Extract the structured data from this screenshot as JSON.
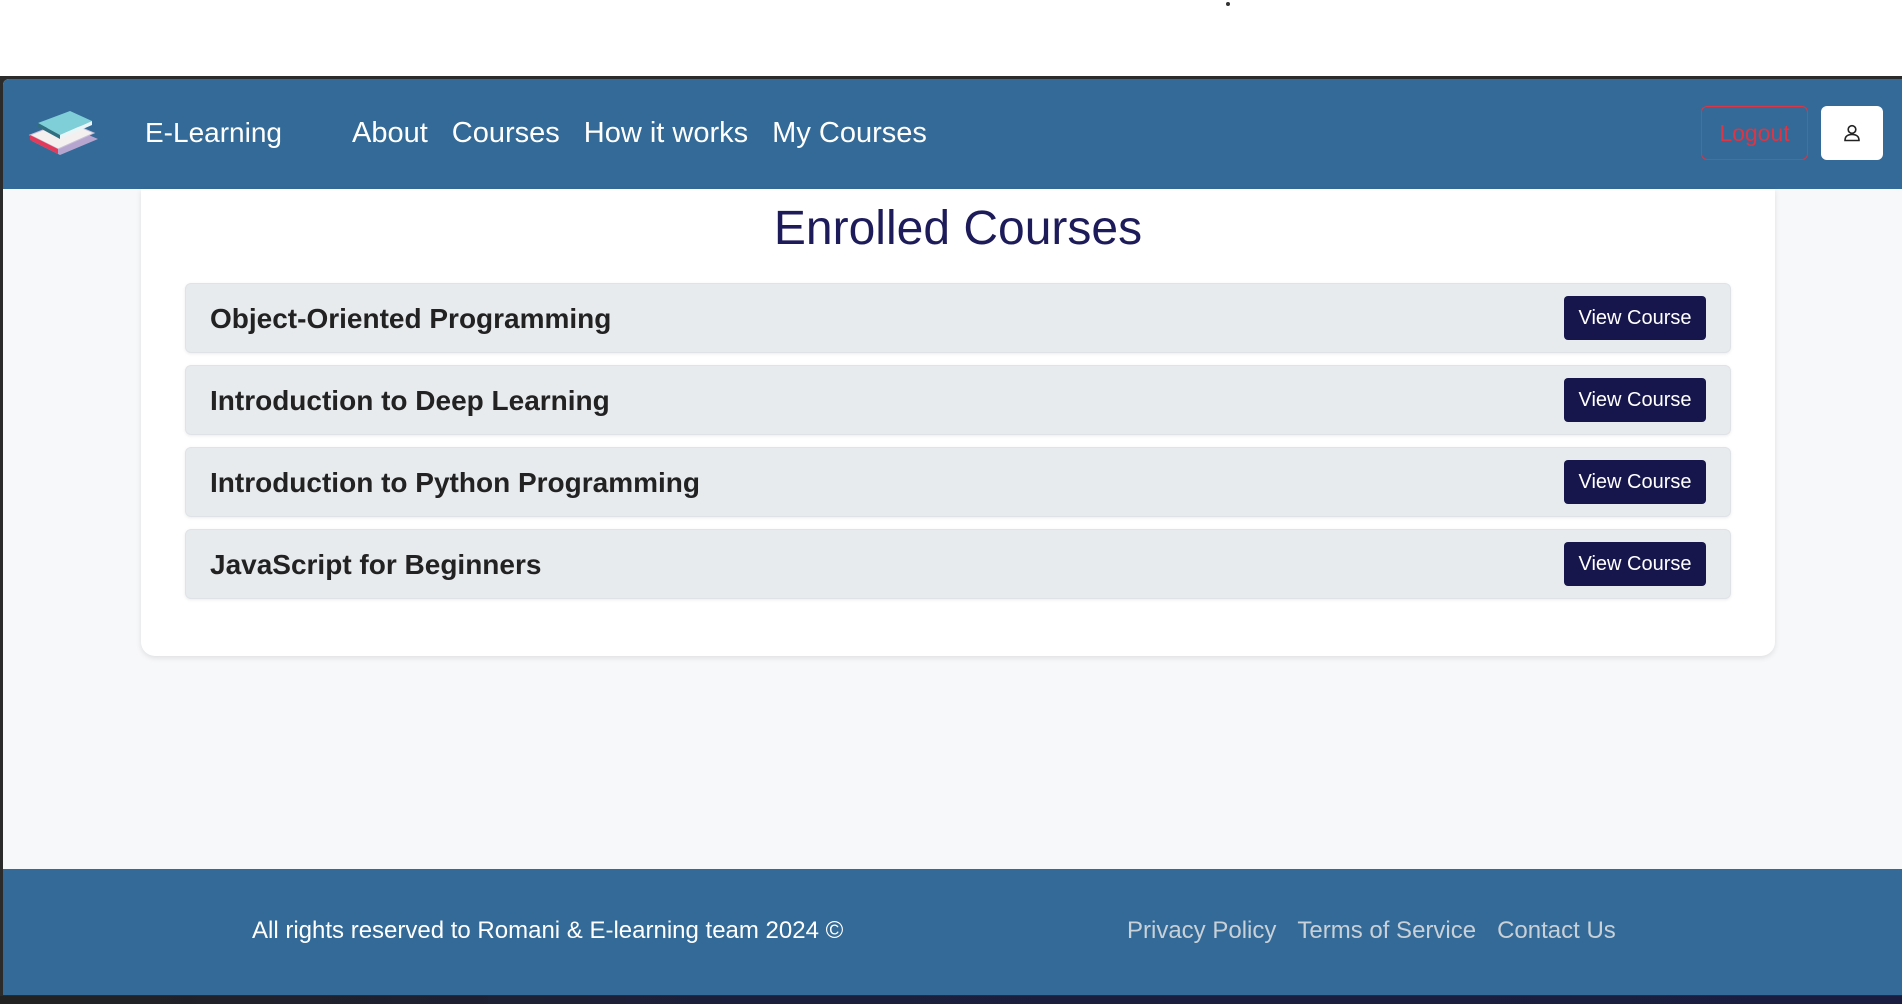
{
  "navbar": {
    "brand": "E-Learning",
    "links": [
      "About",
      "Courses",
      "How it works",
      "My Courses"
    ],
    "logout_label": "Logout",
    "logo_icon": "books-icon",
    "profile_icon": "user-icon"
  },
  "main": {
    "title": "Enrolled Courses",
    "courses": [
      {
        "name": "Object-Oriented Programming",
        "button": "View Course"
      },
      {
        "name": "Introduction to Deep Learning",
        "button": "View Course"
      },
      {
        "name": "Introduction to Python Programming",
        "button": "View Course"
      },
      {
        "name": "JavaScript for Beginners",
        "button": "View Course"
      }
    ]
  },
  "footer": {
    "copyright": "All rights reserved to Romani & E-learning team 2024 ©",
    "links": [
      "Privacy Policy",
      "Terms of Service",
      "Contact Us"
    ]
  },
  "colors": {
    "nav_bg": "#336a97",
    "title_color": "#1d1b5a",
    "button_bg": "#16164d",
    "logout_color": "#dc3545"
  }
}
